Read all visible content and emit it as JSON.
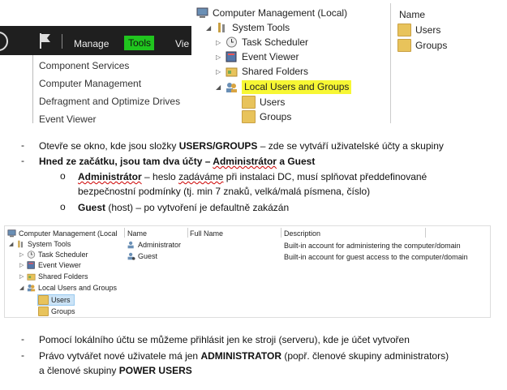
{
  "server_manager": {
    "menu_bar": {
      "manage": "Manage",
      "tools": "Tools",
      "view": "Vie"
    },
    "tools_menu": [
      "Component Services",
      "Computer Management",
      "Defragment and Optimize Drives",
      "Event Viewer"
    ]
  },
  "cm_top": {
    "root": "Computer Management (Local)",
    "system_tools": "System Tools",
    "task_scheduler": "Task Scheduler",
    "event_viewer": "Event Viewer",
    "shared_folders": "Shared Folders",
    "local_users_groups": "Local Users and Groups",
    "users": "Users",
    "groups": "Groups",
    "pane_header": "Name",
    "pane_items": [
      "Users",
      "Groups"
    ],
    "highlight_color": "#f7f734"
  },
  "bullets1": {
    "b1_prefix": "Otevře se okno, kde jsou složky ",
    "b1_bold": "USERS/GROUPS",
    "b1_suffix": " – zde se vytváří uživatelské účty a skupiny",
    "b2_a": "Hned ze začátku, jsou tam dva účty – ",
    "b2_b": "Administrátor",
    "b2_c": " a Guest",
    "sub1_bold": "Administrátor",
    "sub1_a": " – heslo ",
    "sub1_b": "zadáváme",
    "sub1_c": " při instalaci DC, musí splňovat předdefinované",
    "sub1_line2": "bezpečnostní podmínky (tj. min 7 znaků, velká/malá písmena, číslo)",
    "sub2_bold": "Guest",
    "sub2_rest": " (host) – po vytvoření je defaultně zakázán",
    "sub_marker": "o",
    "dash": "-"
  },
  "cm_bottom": {
    "root": "Computer Management (Local",
    "system_tools": "System Tools",
    "task_scheduler": "Task Scheduler",
    "event_viewer": "Event Viewer",
    "shared_folders": "Shared Folders",
    "local_users_groups": "Local Users and Groups",
    "users": "Users",
    "groups": "Groups",
    "columns": [
      "Name",
      "Full Name",
      "Description"
    ],
    "rows": [
      {
        "name": "Administrator",
        "full_name": "",
        "description": "Built-in account for administering the computer/domain"
      },
      {
        "name": "Guest",
        "full_name": "",
        "description": "Built-in account for guest access to the computer/domain"
      }
    ]
  },
  "bullets2": {
    "b3": "Pomocí lokálního účtu se můžeme přihlásit jen ke stroji (serveru), kde je účet vytvořen",
    "b4_a": "Právo vytvářet nové uživatele má jen ",
    "b4_bold": "ADMINISTRATOR",
    "b4_b": " (popř. členové skupiny administrators)",
    "b4_line2_a": "a členové skupiny ",
    "b4_line2_bold": "POWER USERS",
    "dash": "-"
  }
}
